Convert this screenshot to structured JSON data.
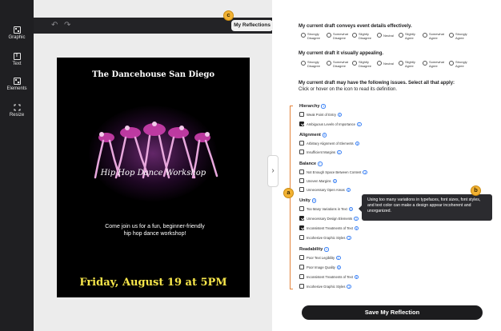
{
  "rail": {
    "items": [
      {
        "label": "Graphic",
        "icon": "graphic-icon"
      },
      {
        "label": "Text",
        "icon": "text-icon"
      },
      {
        "label": "Elements",
        "icon": "elements-icon"
      },
      {
        "label": "Resize",
        "icon": "resize-icon"
      }
    ]
  },
  "toolbar": {
    "undo_glyph": "↶",
    "redo_glyph": "↷",
    "my_reflections_label": "My Reflections"
  },
  "badges": {
    "a": "a",
    "b": "b",
    "c": "c"
  },
  "poster": {
    "title": "The Dancehouse San Diego",
    "workshop": "Hip Hop Dance Workshop",
    "cta": "Come join us for a fun, beginner-friendly hip hop dance workshop!",
    "date": "Friday, August 19 at 5PM"
  },
  "collapse_glyph": "›",
  "questions": [
    {
      "text": "My current draft conveys event details effectively."
    },
    {
      "text": "My current draft it visually appealing."
    }
  ],
  "scale_options": [
    [
      "Strongly",
      "Disagree"
    ],
    [
      "Somewhat",
      "Disagree"
    ],
    [
      "Slightly",
      "Disagree"
    ],
    [
      "Neutral",
      ""
    ],
    [
      "Slightly",
      "Agree"
    ],
    [
      "Somewhat",
      "Agree"
    ],
    [
      "Strongly",
      "Agree"
    ]
  ],
  "issues_prompt": "My current draft may have the following issues. Select all that apply:",
  "issues_sub": "Click or hover on the icon to read its definition.",
  "info_glyph": "i",
  "categories": [
    {
      "name": "Hierarchy",
      "items": [
        {
          "label": "Weak Point of Entry",
          "checked": false
        },
        {
          "label": "Ambiguous Levels of Importance",
          "checked": true
        }
      ]
    },
    {
      "name": "Alignment",
      "items": [
        {
          "label": "Arbitrary Alignment of Elements",
          "checked": false
        },
        {
          "label": "Insufficient Margins",
          "checked": false
        }
      ]
    },
    {
      "name": "Balance",
      "items": [
        {
          "label": "Not Enough Space Between Content",
          "checked": false
        },
        {
          "label": "Uneven Margins",
          "checked": false
        },
        {
          "label": "Unnecessary Open Areas",
          "checked": false
        }
      ]
    },
    {
      "name": "Unity",
      "items": [
        {
          "label": "Too Many Variations in Text",
          "checked": false
        },
        {
          "label": "Unnecessary Design Elements",
          "checked": true
        },
        {
          "label": "Inconsistent Treatments of Text",
          "checked": true
        },
        {
          "label": "Incohesive Graphic Styles",
          "checked": false
        }
      ]
    },
    {
      "name": "Readability",
      "items": [
        {
          "label": "Poor Text Legibility",
          "checked": false
        },
        {
          "label": "Poor Image Quality",
          "checked": false
        },
        {
          "label": "Inconsistent Treatments of Text",
          "checked": false
        },
        {
          "label": "Incohesive Graphic Styles",
          "checked": false
        }
      ]
    }
  ],
  "tooltip": "Using too many variations in typefaces, font sizes, font styles, and text color can make a design appear incoherent and unorganized.",
  "save_label": "Save My Reflection",
  "colors": {
    "accent": "#f2b233",
    "bracket": "#e3833b",
    "info": "#3b82f6",
    "poster_date": "#f7e64a"
  }
}
